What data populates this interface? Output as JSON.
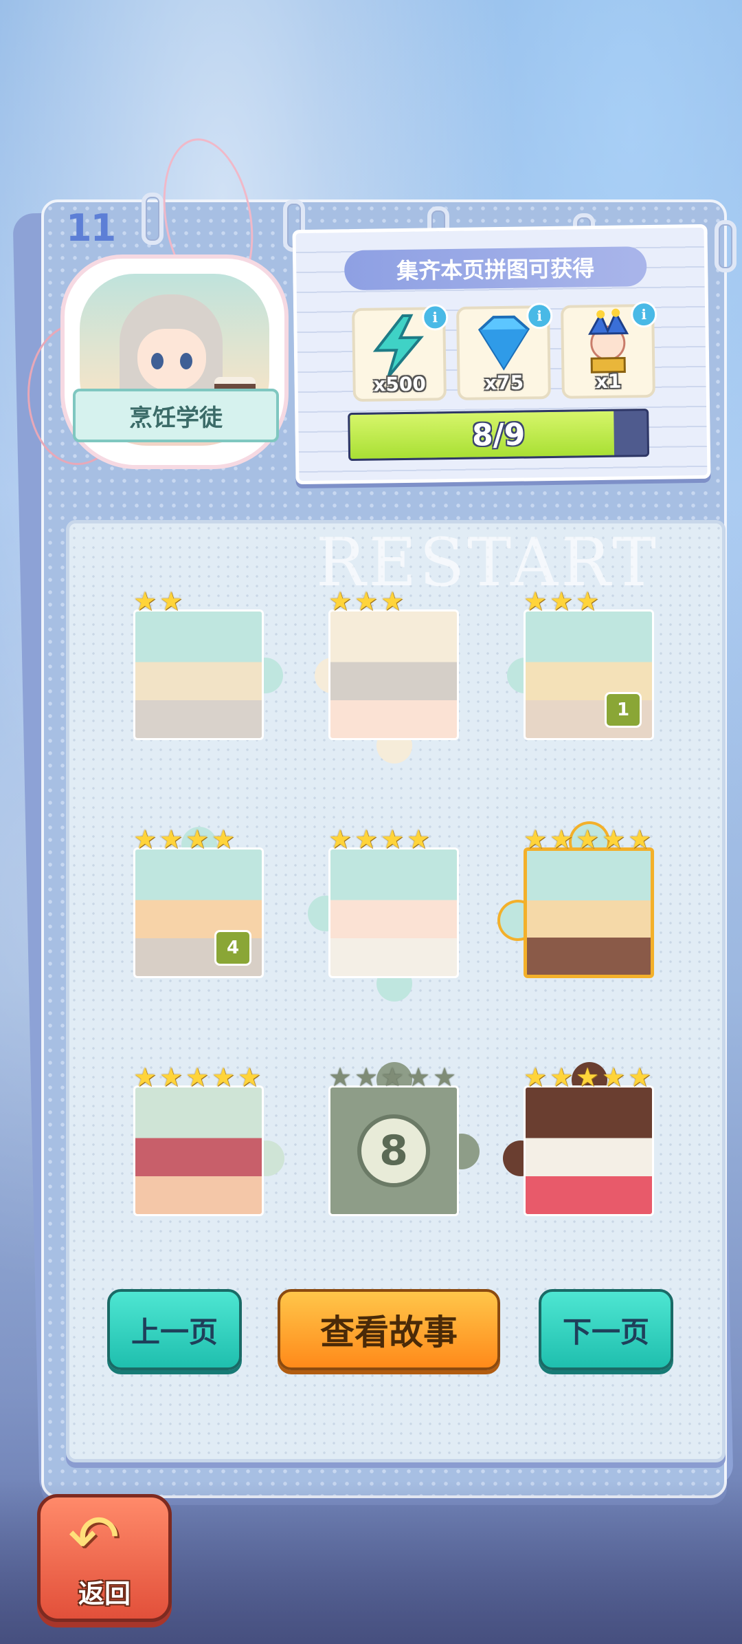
{
  "chapter_number": "11",
  "badge": {
    "title": "烹饪学徒"
  },
  "reward_panel": {
    "title": "集齐本页拼图可获得",
    "rewards": [
      {
        "name": "energy",
        "icon": "lightning-icon",
        "quantity": "x500"
      },
      {
        "name": "diamond",
        "icon": "diamond-icon",
        "quantity": "x75"
      },
      {
        "name": "jester-character",
        "icon": "jester-icon",
        "quantity": "x1"
      }
    ],
    "progress_text": "8/9",
    "progress_fraction": 0.889
  },
  "watermark": "RESTART",
  "pieces": [
    {
      "stars": 2,
      "max_stars": 2,
      "count": "",
      "locked": false
    },
    {
      "stars": 3,
      "max_stars": 3,
      "count": "",
      "locked": false
    },
    {
      "stars": 3,
      "max_stars": 3,
      "count": "1",
      "locked": false
    },
    {
      "stars": 4,
      "max_stars": 4,
      "count": "4",
      "locked": false
    },
    {
      "stars": 4,
      "max_stars": 4,
      "count": "",
      "locked": false
    },
    {
      "stars": 5,
      "max_stars": 5,
      "count": "",
      "locked": false,
      "highlight": true
    },
    {
      "stars": 5,
      "max_stars": 5,
      "count": "",
      "locked": false
    },
    {
      "stars": 0,
      "max_stars": 5,
      "count": "",
      "locked": true,
      "number": "8"
    },
    {
      "stars": 5,
      "max_stars": 5,
      "count": "",
      "locked": false
    }
  ],
  "buttons": {
    "prev": "上一页",
    "story": "查看故事",
    "next": "下一页",
    "back": "返回"
  },
  "colors": {
    "star": "#ffd43a",
    "progress_fill": "#b4e63c",
    "button_teal": "#2ed1bd",
    "button_orange": "#ff9c26",
    "back_button": "#ea5a42"
  }
}
